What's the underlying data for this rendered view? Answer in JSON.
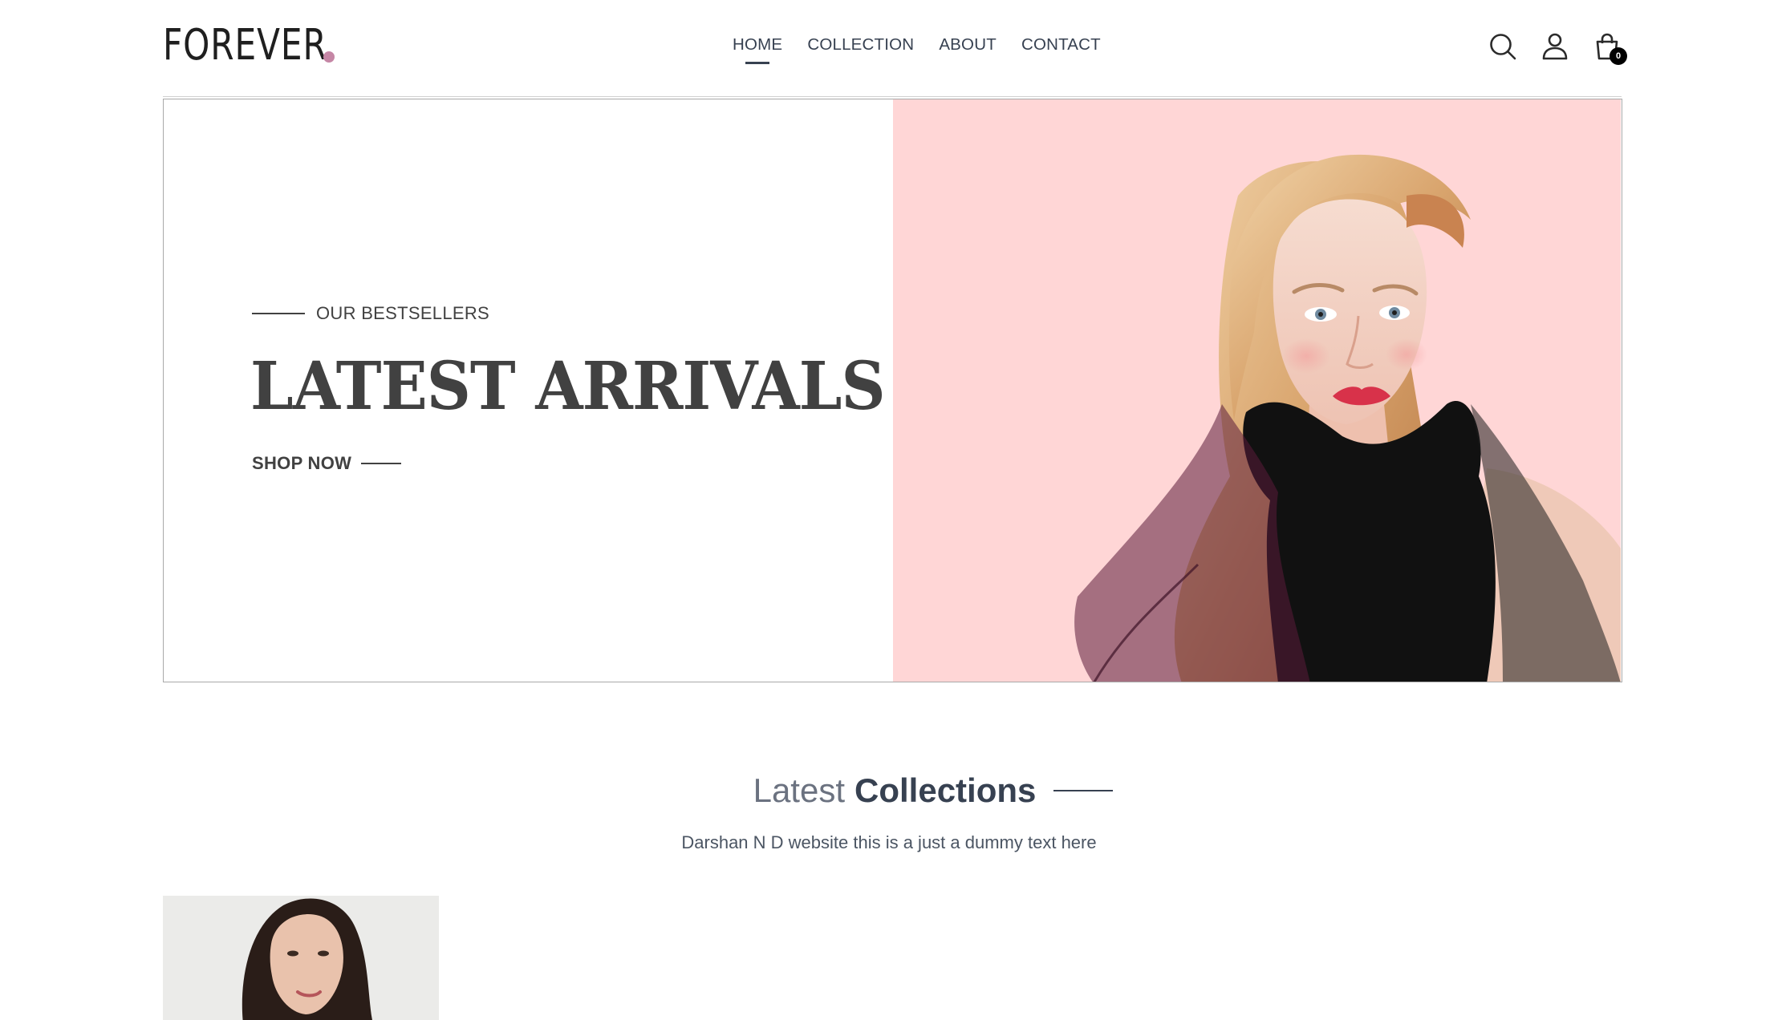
{
  "brand": {
    "name": "FOREVER",
    "dot_color": "#c586a5"
  },
  "nav": {
    "items": [
      {
        "label": "HOME",
        "active": true
      },
      {
        "label": "COLLECTION",
        "active": false
      },
      {
        "label": "ABOUT",
        "active": false
      },
      {
        "label": "CONTACT",
        "active": false
      }
    ]
  },
  "header_icons": {
    "search": "search-icon",
    "profile": "user-icon",
    "cart": "shopping-bag-icon",
    "cart_count": "0"
  },
  "hero": {
    "eyebrow": "OUR BESTSELLERS",
    "title": "LATEST ARRIVALS",
    "cta": "SHOP NOW",
    "image_bg": "#ffd6d6"
  },
  "collections": {
    "title_light": "Latest",
    "title_bold": "Collections",
    "subtitle": "Darshan N D website this is a just a dummy text here"
  },
  "colors": {
    "text_dark": "#374151",
    "text_muted": "#6b7280",
    "hero_text": "#414141"
  }
}
